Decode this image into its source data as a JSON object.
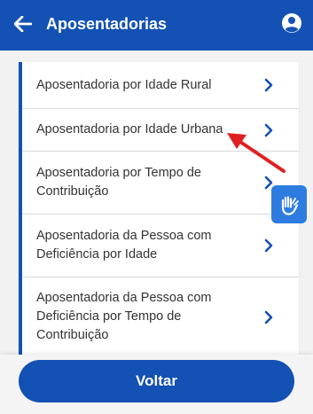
{
  "appbar": {
    "title": "Aposentadorias",
    "back_icon": "arrow-left-icon",
    "account_icon": "user-circle-icon"
  },
  "list": {
    "items": [
      {
        "label": "Aposentadoria por Idade Rural"
      },
      {
        "label": "Aposentadoria por Idade Urbana"
      },
      {
        "label": "Aposentadoria por Tempo de Contribuição"
      },
      {
        "label": "Aposentadoria da Pessoa com Deficiência por Idade"
      },
      {
        "label": "Aposentadoria da Pessoa com Deficiência por Tempo de Contribuição"
      }
    ],
    "chevron_icon": "chevron-right-icon"
  },
  "libras_icon": "hand-talk-icon",
  "annotation": {
    "icon": "red-arrow-icon",
    "color": "#e02020"
  },
  "footer": {
    "button_label": "Voltar"
  },
  "colors": {
    "primary": "#1351b4",
    "libras": "#2e7ce0",
    "text": "#333333"
  }
}
